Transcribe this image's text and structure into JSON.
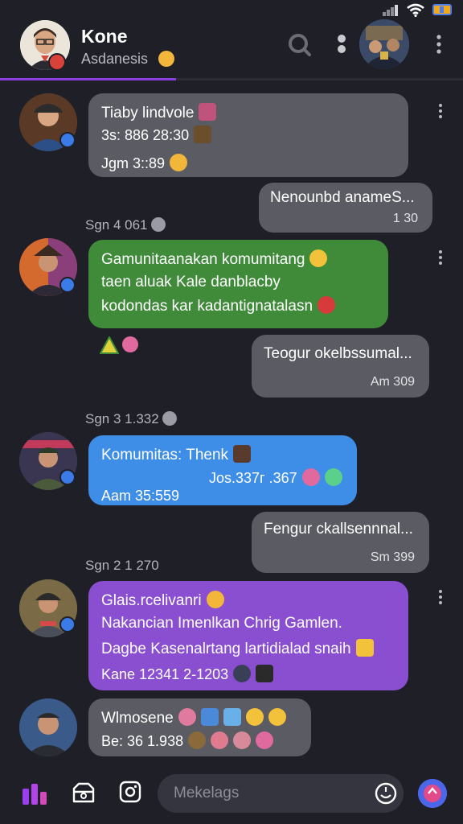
{
  "header": {
    "name": "Kone",
    "subtitle": "Asdanesis",
    "progress": 0.38
  },
  "messages": [
    {
      "type": "in",
      "color": "gray",
      "lines": [
        "Tiaby lindvole",
        "3s: 886 28:30",
        "Jgm 3::89"
      ]
    },
    {
      "type": "out",
      "text": "Nenounbd anameS...",
      "time": "1 30"
    },
    {
      "type": "stamp",
      "text": "Sgn 4 061"
    },
    {
      "type": "in",
      "color": "green",
      "lines": [
        "Gamunitaanakan komumitang",
        "taen aluak Kale danblacby",
        "kodondas kar kadantignatalasn"
      ]
    },
    {
      "type": "out",
      "text": "Teogur okelbssumal...",
      "time": "Am 309"
    },
    {
      "type": "stamp",
      "text": "Sgn 3 1.332"
    },
    {
      "type": "in",
      "color": "blue",
      "lines": [
        "Komumitas: Thenk",
        "Jos.337г .367",
        "Aam 35:559"
      ]
    },
    {
      "type": "out",
      "text": "Fengur ckallsennnal...",
      "time": "Sm 399"
    },
    {
      "type": "stamp",
      "text": "Sgn 2 1 270"
    },
    {
      "type": "in",
      "color": "purple",
      "lines": [
        "Glais.rcelivanri",
        "Nakancian Imenlkan Chrig Gamlen.",
        "Dagbe Kasenalrtang lartidialad snaih",
        "Kane 12341 2-1203"
      ]
    },
    {
      "type": "in",
      "color": "gray",
      "lines": [
        "Wlmosene",
        "Be: 36 1.938"
      ]
    }
  ],
  "composer": {
    "placeholder": "Mekelags"
  },
  "colors": {
    "background": "#1e1f27",
    "bubble_gray": "#5b5c63",
    "bubble_green": "#3f8b3a",
    "bubble_blue": "#3e8ee8",
    "bubble_purple": "#8a4fd0",
    "accent": "#8b3fe0"
  },
  "icons": [
    "signal-icon",
    "wifi-icon",
    "battery-icon",
    "search-icon",
    "more-icon",
    "app-logo-icon",
    "camera-bag-icon",
    "instagram-icon",
    "emoji-icon",
    "send-icon"
  ]
}
